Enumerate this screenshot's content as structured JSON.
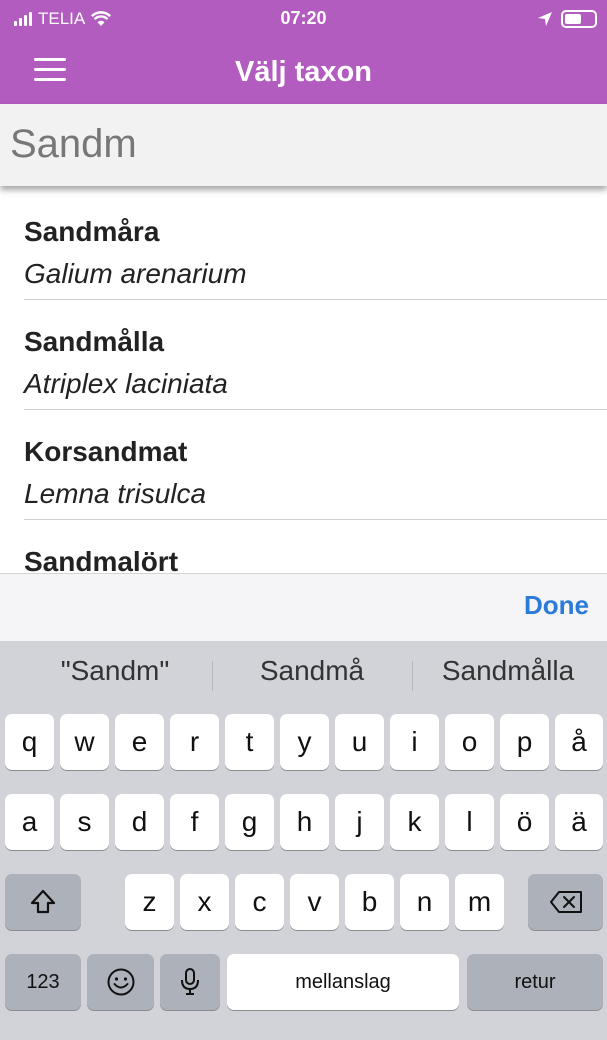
{
  "status": {
    "carrier": "TELIA",
    "time": "07:20"
  },
  "nav": {
    "title": "Välj taxon"
  },
  "search": {
    "value": "Sandm"
  },
  "results": [
    {
      "name": "Sandmåra",
      "scientific": "Galium arenarium"
    },
    {
      "name": "Sandmålla",
      "scientific": "Atriplex laciniata"
    },
    {
      "name": "Korsandmat",
      "scientific": "Lemna trisulca"
    },
    {
      "name": "Sandmalört",
      "scientific": ""
    }
  ],
  "accessory": {
    "done_label": "Done"
  },
  "keyboard": {
    "suggestions": [
      "\"Sandm\"",
      "Sandmå",
      "Sandmålla"
    ],
    "row1": [
      "q",
      "w",
      "e",
      "r",
      "t",
      "y",
      "u",
      "i",
      "o",
      "p",
      "å"
    ],
    "row2": [
      "a",
      "s",
      "d",
      "f",
      "g",
      "h",
      "j",
      "k",
      "l",
      "ö",
      "ä"
    ],
    "row3": [
      "z",
      "x",
      "c",
      "v",
      "b",
      "n",
      "m"
    ],
    "numbers_label": "123",
    "space_label": "mellanslag",
    "return_label": "retur"
  },
  "colors": {
    "accent": "#b35cc0",
    "done": "#2b7bd8",
    "keyboard_bg": "#d1d3d9"
  },
  "icons": [
    "signal-icon",
    "wifi-icon",
    "location-arrow-icon",
    "battery-icon",
    "menu-icon",
    "shift-icon",
    "backspace-icon",
    "emoji-icon",
    "microphone-icon"
  ]
}
